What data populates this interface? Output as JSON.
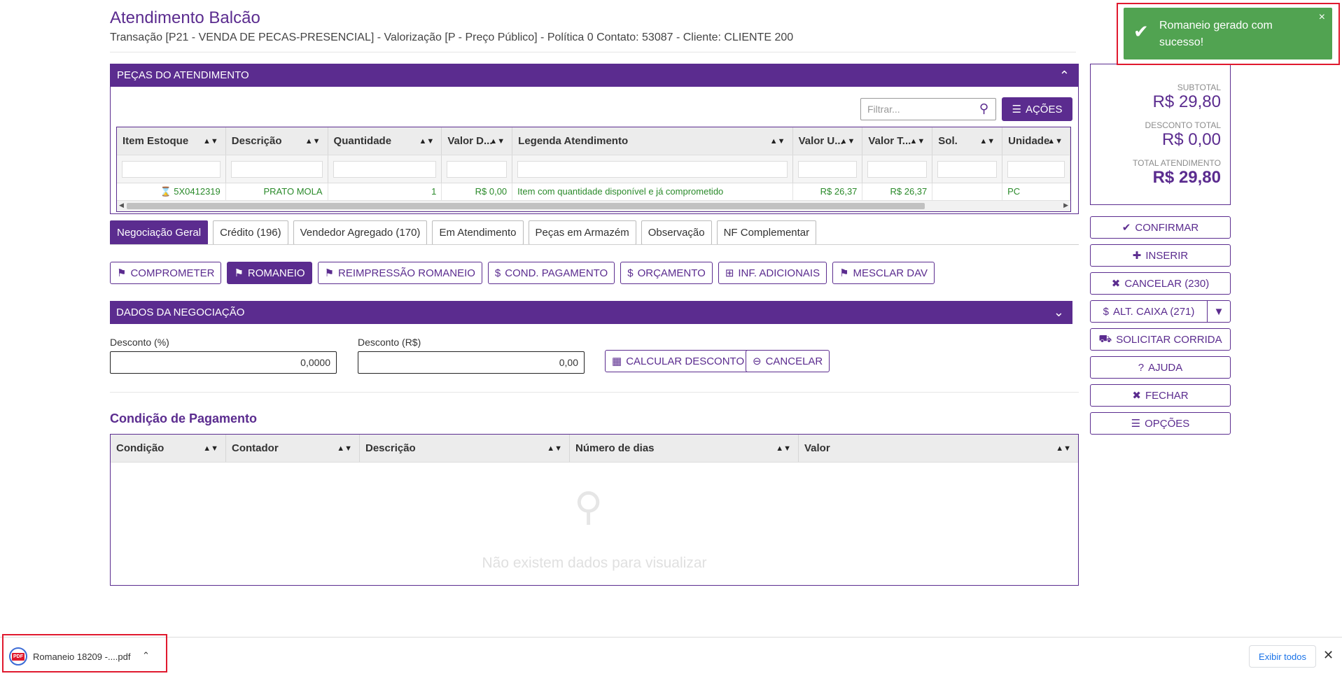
{
  "header": {
    "title": "Atendimento Balcão",
    "subtitle": "Transação [P21 - VENDA DE PECAS-PRESENCIAL] - Valorização [P - Preço Público] - Política 0 Contato: 53087 - Cliente: CLIENTE 200"
  },
  "pecas_panel": {
    "title": "PEÇAS DO ATENDIMENTO",
    "filter_placeholder": "Filtrar...",
    "acoes_label": "AÇÕES",
    "columns": [
      "Item Estoque",
      "Descrição",
      "Quantidade",
      "Valor D...",
      "Legenda Atendimento",
      "Valor U...",
      "Valor T...",
      "Sol.",
      "Unidade"
    ],
    "rows": [
      {
        "item": "5X0412319",
        "descricao": "PRATO MOLA",
        "quantidade": "1",
        "valor_d": "R$ 0,00",
        "legenda": "Item com quantidade disponível e já comprometido",
        "valor_u": "R$ 26,37",
        "valor_t": "R$ 26,37",
        "sol": "",
        "unidade": "PC"
      }
    ]
  },
  "tabs": [
    "Negociação Geral",
    "Crédito (196)",
    "Vendedor Agregado (170)",
    "Em Atendimento",
    "Peças em Armazém",
    "Observação",
    "NF Complementar"
  ],
  "actions": {
    "comprometer": "COMPROMETER",
    "romaneio": "ROMANEIO",
    "reimpressao": "REIMPRESSÃO ROMANEIO",
    "cond_pagamento": "COND. PAGAMENTO",
    "orcamento": "ORÇAMENTO",
    "inf_adicionais": "INF. ADICIONAIS",
    "mesclar_dav": "MESCLAR DAV"
  },
  "negociacao": {
    "title": "DADOS DA NEGOCIAÇÃO",
    "desconto_pct_label": "Desconto (%)",
    "desconto_pct_value": "0,0000",
    "desconto_rs_label": "Desconto (R$)",
    "desconto_rs_value": "0,00",
    "calcular_label": "CALCULAR DESCONTO",
    "cancelar_label": "CANCELAR"
  },
  "condicao": {
    "title": "Condição de Pagamento",
    "columns": [
      "Condição",
      "Contador",
      "Descrição",
      "Número de dias",
      "Valor"
    ],
    "empty_text": "Não existem dados para visualizar"
  },
  "totals": {
    "subtotal_label": "SUBTOTAL",
    "subtotal_value": "R$ 29,80",
    "desconto_label": "DESCONTO TOTAL",
    "desconto_value": "R$ 0,00",
    "total_label": "TOTAL ATENDIMENTO",
    "total_value": "R$ 29,80"
  },
  "side_buttons": {
    "confirmar": "CONFIRMAR",
    "inserir": "INSERIR",
    "cancelar": "CANCELAR (230)",
    "alt_caixa": "ALT. CAIXA (271)",
    "solicitar_corrida": "SOLICITAR CORRIDA",
    "ajuda": "AJUDA",
    "fechar": "FECHAR",
    "opcoes": "OPÇÕES"
  },
  "toast": {
    "message": "Romaneio gerado com sucesso!"
  },
  "download_bar": {
    "file_name": "Romaneio 18209 -....pdf",
    "pdf_badge": "PDF",
    "exibir_todos": "Exibir todos"
  },
  "colors": {
    "brand_purple": "#5b2c8f",
    "success_green": "#51a351",
    "highlight_red": "#e0192e",
    "row_text_green": "#2a8a2a"
  }
}
